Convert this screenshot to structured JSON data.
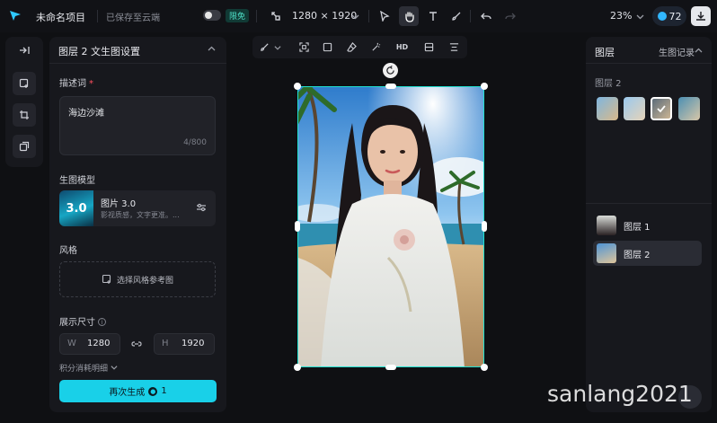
{
  "topbar": {
    "project_name": "未命名项目",
    "save_status": "已保存至云端",
    "limit_badge": "限免",
    "canvas_size": "1280 × 1920",
    "zoom_level": "23%",
    "credits": "72"
  },
  "settings_panel": {
    "title": "图层 2 文生图设置",
    "prompt_label": "描述词",
    "prompt_required_mark": "*",
    "prompt_text": "海边沙滩",
    "prompt_count": "4/800",
    "model_label": "生图模型",
    "model_thumb_text": "3.0",
    "model_name": "图片 3.0",
    "model_desc": "影视质感，文字更准。...",
    "style_label": "风格",
    "style_select": "选择风格参考图",
    "size_label": "展示尺寸",
    "width_key": "W",
    "width_value": "1280",
    "height_key": "H",
    "height_value": "1920",
    "points_detail": "积分消耗明细",
    "regenerate_label": "再次生成",
    "regenerate_cost": "1"
  },
  "canvas_toolbar": {
    "hd_label": "HD"
  },
  "layers_panel": {
    "title": "图层",
    "history": "生图记录",
    "group_label": "图层 2",
    "layers": [
      {
        "name": "图层 1"
      },
      {
        "name": "图层 2"
      }
    ]
  },
  "watermark": "sanlang2021",
  "colors": {
    "accent": "#19d0e8",
    "selection": "#1fe0d0",
    "background": "#0f1013",
    "panel": "#17181d"
  }
}
